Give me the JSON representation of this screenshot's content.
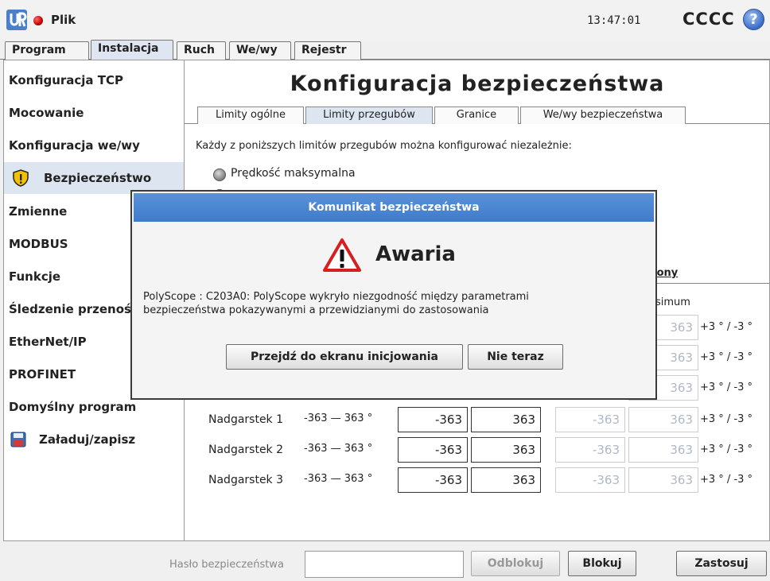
{
  "topbar": {
    "app_menu": "Plik",
    "time": "13:47:01",
    "robot_name": "CCCC",
    "help_symbol": "?"
  },
  "main_tabs": [
    "Program",
    "Instalacja",
    "Ruch",
    "We/wy",
    "Rejestr"
  ],
  "sidebar": {
    "items": [
      "Konfiguracja TCP",
      "Mocowanie",
      "Konfiguracja we/wy",
      "Bezpieczeństwo",
      "Zmienne",
      "MODBUS",
      "Funkcje",
      "Śledzenie przenośnika",
      "EtherNet/IP",
      "PROFINET",
      "Domyślny program",
      "Załaduj/zapisz"
    ]
  },
  "page": {
    "title": "Konfiguracja bezpieczeństwa",
    "sub_tabs": [
      "Limity ogólne",
      "Limity przegubów",
      "Granice",
      "We/wy bezpieczeństwa"
    ],
    "intro": "Każdy z poniższych limitów przegubów można konfigurować niezależnie:",
    "radio_label": "Prędkość maksymalna",
    "col_reduced": "zony",
    "col_maximum": "simum",
    "joints": [
      {
        "name": "",
        "range": "",
        "min": "",
        "max": "",
        "red_min": "",
        "red_max": "363",
        "tol": "+3 ° / -3 °"
      },
      {
        "name": "",
        "range": "",
        "min": "",
        "max": "",
        "red_min": "",
        "red_max": "363",
        "tol": "+3 ° / -3 °"
      },
      {
        "name": "",
        "range": "",
        "min": "",
        "max": "",
        "red_min": "",
        "red_max": "363",
        "tol": "+3 ° / -3 °"
      },
      {
        "name": "Nadgarstek 1",
        "range": "-363 — 363 °",
        "min": "-363",
        "max": "363",
        "red_min": "-363",
        "red_max": "363",
        "tol": "+3 ° / -3 °"
      },
      {
        "name": "Nadgarstek 2",
        "range": "-363 — 363 °",
        "min": "-363",
        "max": "363",
        "red_min": "-363",
        "red_max": "363",
        "tol": "+3 ° / -3 °"
      },
      {
        "name": "Nadgarstek 3",
        "range": "-363 — 363 °",
        "min": "-363",
        "max": "363",
        "red_min": "-363",
        "red_max": "363",
        "tol": "+3 ° / -3 °"
      }
    ]
  },
  "bottom": {
    "password_label": "Hasło bezpieczeństwa",
    "password_value": "",
    "unlock": "Odblokuj",
    "lock": "Blokuj",
    "apply": "Zastosuj"
  },
  "dialog": {
    "title": "Komunikat bezpieczeństwa",
    "heading": "Awaria",
    "message_line1": "PolyScope : C203A0: PolyScope wykryło niezgodność między parametrami",
    "message_line2": "bezpieczeństwa pokazywanymi a przewidzianymi do zastosowania",
    "primary_button": "Przejdź do ekranu inicjowania",
    "secondary_button": "Nie teraz"
  },
  "colors": {
    "accent": "#3f7bcc",
    "selection": "#dde5f1",
    "warning_red": "#d42020",
    "shield_yellow": "#f2c200"
  }
}
